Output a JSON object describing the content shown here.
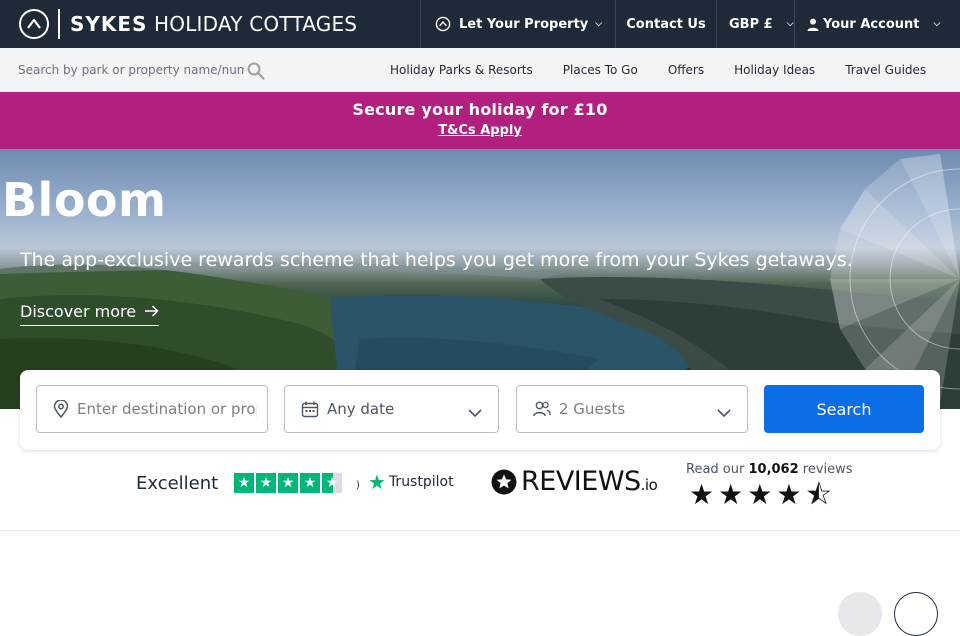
{
  "header": {
    "brand_bold": "SYKES",
    "brand_rest": "HOLIDAY COTTAGES",
    "nav": {
      "let_property": "Let Your Property",
      "contact": "Contact Us",
      "currency": "GBP £",
      "account": "Your Account"
    }
  },
  "subnav": {
    "search_placeholder": "Search by park or property name/number",
    "links": [
      "Holiday Parks & Resorts",
      "Places To Go",
      "Offers",
      "Holiday Ideas",
      "Travel Guides"
    ]
  },
  "promo": {
    "title": "Secure your holiday for £10",
    "link": "T&Cs Apply",
    "color": "#b11f7f"
  },
  "hero": {
    "title": "Bloom",
    "subtitle": "The app-exclusive rewards scheme that helps you get more from your Sykes getaways.",
    "cta": "Discover more"
  },
  "search": {
    "destination_placeholder": "Enter destination or property",
    "date_value": "Any date",
    "guests_value": "2 Guests",
    "button": "Search",
    "button_color": "#0b6ee6"
  },
  "reviews": {
    "trustpilot_rating": "Excellent",
    "trustpilot_stars": 4.5,
    "trustpilot_label": "Trustpilot",
    "reviewsio_brand": "REVIEWS",
    "reviewsio_suffix": ".io",
    "read_prefix": "Read our",
    "count": "10,062",
    "read_suffix": "reviews",
    "reviewsio_stars": 4.5
  },
  "icons": {
    "brand": "compass-logo-icon",
    "let": "house-circle-icon",
    "account": "user-icon",
    "search": "magnifier-icon",
    "location": "map-pin-icon",
    "calendar": "calendar-icon",
    "guests": "users-icon",
    "chevron": "chevron-down-icon",
    "arrow": "arrow-right-icon"
  }
}
